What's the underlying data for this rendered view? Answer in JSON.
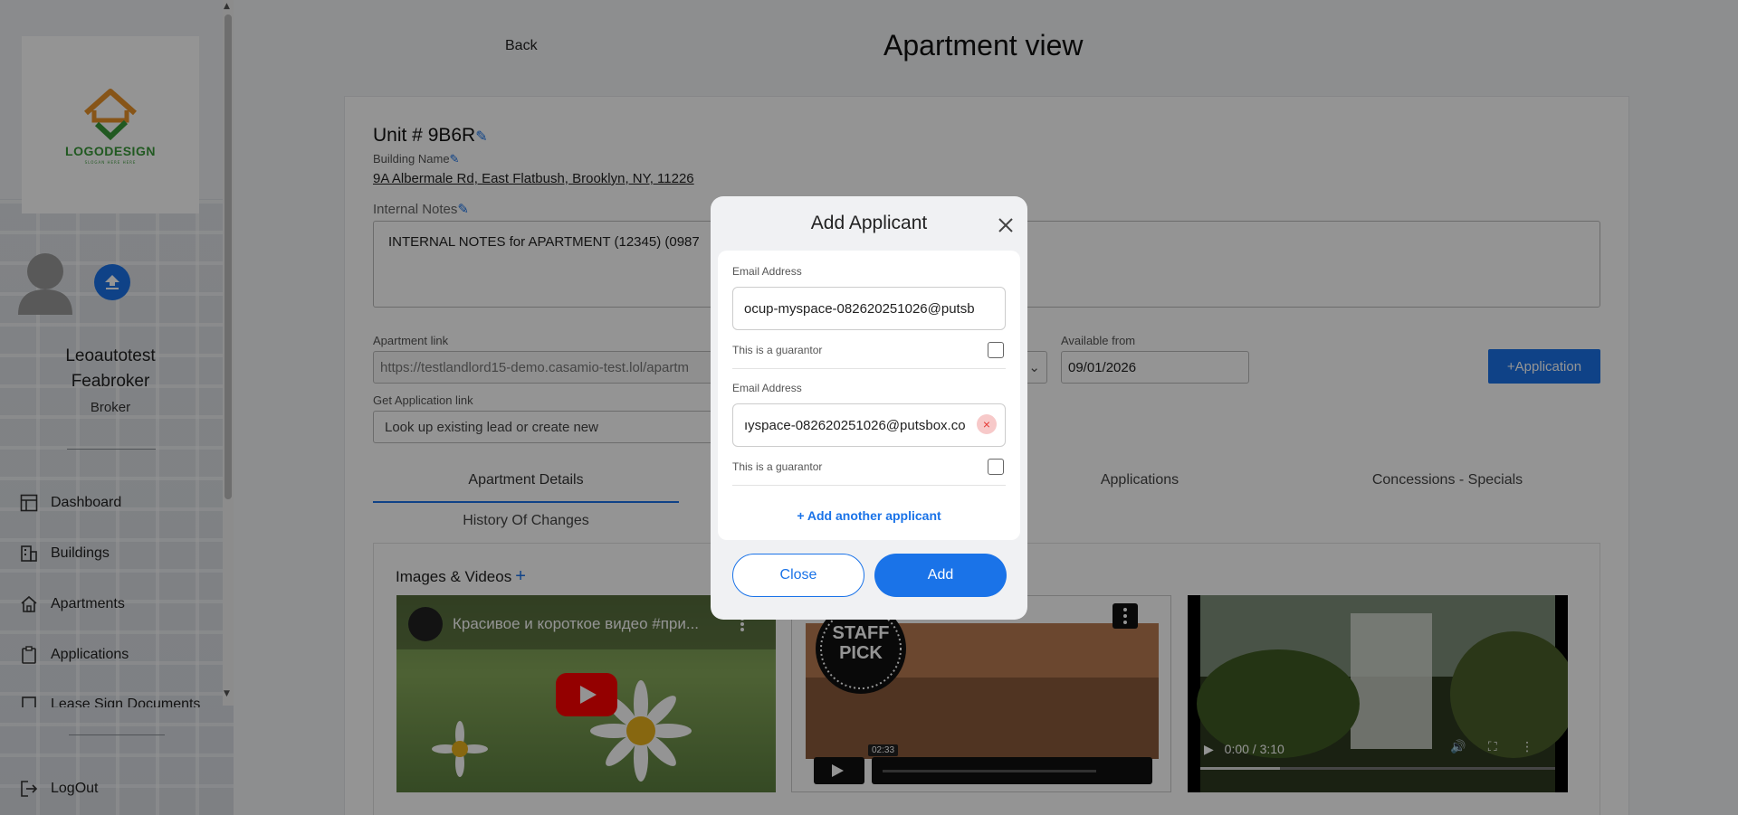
{
  "sidebar": {
    "logo": {
      "text": "LOGODESIGN",
      "slogan": "SLOGAN HERE HERE"
    },
    "user": {
      "first_name": "Leoautotest",
      "last_name": "Feabroker",
      "role": "Broker"
    },
    "nav": [
      {
        "label": "Dashboard",
        "icon": "dashboard-icon"
      },
      {
        "label": "Buildings",
        "icon": "building-icon"
      },
      {
        "label": "Apartments",
        "icon": "home-icon"
      },
      {
        "label": "Applications",
        "icon": "clipboard-icon"
      },
      {
        "label": "Lease Sign Documents",
        "icon": "document-icon"
      }
    ],
    "logout_label": "LogOut"
  },
  "header": {
    "back_label": "Back",
    "title": "Apartment view"
  },
  "apartment": {
    "unit_label": "Unit # 9B6R",
    "building_name_label": "Building Name",
    "address": "9A Albermale Rd, East Flatbush, Brooklyn, NY, 11226",
    "notes_label": "Internal Notes",
    "notes_text": "INTERNAL NOTES for APARTMENT (12345) (0987",
    "apartment_link_label": "Apartment link",
    "apartment_link_value": "https://testlandlord15-demo.casamio-test.lol/apartm",
    "available_from_label": "Available from",
    "available_from_value": "09/01/2026",
    "application_button": "+Application",
    "get_application_link_label": "Get Application link",
    "get_application_link_placeholder": "Look up existing lead or create new"
  },
  "tabs": [
    {
      "label": "Apartment Details",
      "active": true
    },
    {
      "label": "Applications",
      "active": false
    },
    {
      "label": "Concessions - Specials",
      "active": false
    },
    {
      "label": "History Of Changes",
      "active": false
    }
  ],
  "media": {
    "title": "Images & Videos",
    "add_symbol": "+",
    "videos": [
      {
        "title": "Красивое и короткое видео #при...",
        "provider": "youtube"
      },
      {
        "badge": "STAFF PICK",
        "duration": "02:33",
        "provider": "vimeo"
      },
      {
        "time": "0:00 / 3:10",
        "provider": "html5"
      }
    ]
  },
  "modal": {
    "title": "Add Applicant",
    "applicants": [
      {
        "email_label": "Email Address",
        "email_value": "ocup-myspace-082620251026@putsb",
        "guarantor_label": "This is a guarantor",
        "guarantor": false
      },
      {
        "email_label": "Email Address",
        "email_value": "ıyspace-082620251026@putsbox.co",
        "guarantor_label": "This is a guarantor",
        "guarantor": false
      }
    ],
    "add_another_label": "+ Add another applicant",
    "close_label": "Close",
    "add_label": "Add",
    "accent_color": "#1a73e8"
  }
}
